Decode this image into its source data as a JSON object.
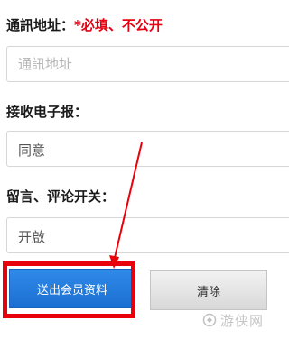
{
  "address": {
    "label": "通訊地址：",
    "required_note": "*必填、不公开",
    "placeholder": "通訊地址"
  },
  "newsletter": {
    "label": "接收电子报：",
    "value": "同意"
  },
  "comments": {
    "label": "留言、评论开关：",
    "value": "开啟"
  },
  "buttons": {
    "submit_label": "送出会员资料",
    "clear_label": "清除"
  },
  "watermark": {
    "text": "游侠网"
  },
  "colors": {
    "required": "#e60012",
    "submit": "#1c6fd2",
    "highlight": "#e8000b"
  }
}
